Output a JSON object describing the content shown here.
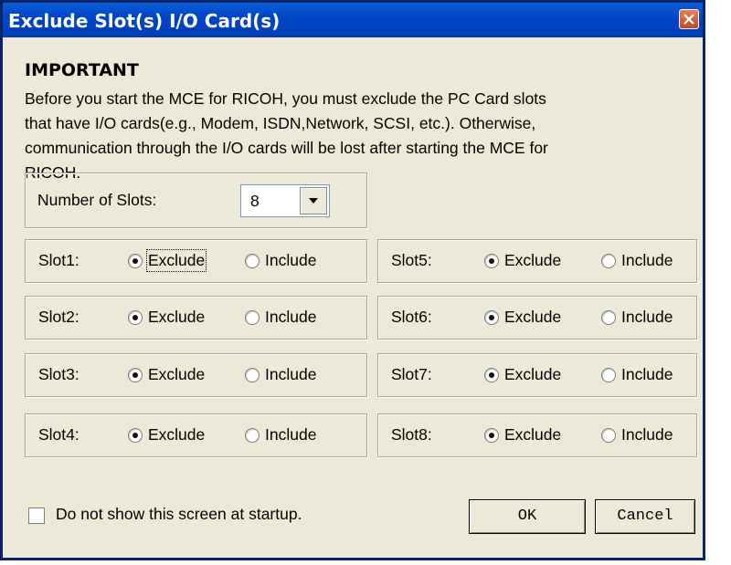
{
  "window": {
    "title": "Exclude Slot(s) I/O Card(s)"
  },
  "notice": {
    "heading": "IMPORTANT",
    "lines": [
      "Before you start the MCE for RICOH, you must exclude the PC Card slots",
      "that have I/O cards(e.g., Modem, ISDN,Network, SCSI, etc.). Otherwise,",
      "communication through the I/O cards will be lost after starting the MCE for",
      "RICOH."
    ]
  },
  "slot_count": {
    "label": "Number of Slots:",
    "value": "8"
  },
  "slots": [
    {
      "label": "Slot1:",
      "exclude": "Exclude",
      "include": "Include",
      "selected": "exclude"
    },
    {
      "label": "Slot2:",
      "exclude": "Exclude",
      "include": "Include",
      "selected": "exclude"
    },
    {
      "label": "Slot3:",
      "exclude": "Exclude",
      "include": "Include",
      "selected": "exclude"
    },
    {
      "label": "Slot4:",
      "exclude": "Exclude",
      "include": "Include",
      "selected": "exclude"
    },
    {
      "label": "Slot5:",
      "exclude": "Exclude",
      "include": "Include",
      "selected": "exclude"
    },
    {
      "label": "Slot6:",
      "exclude": "Exclude",
      "include": "Include",
      "selected": "exclude"
    },
    {
      "label": "Slot7:",
      "exclude": "Exclude",
      "include": "Include",
      "selected": "exclude"
    },
    {
      "label": "Slot8:",
      "exclude": "Exclude",
      "include": "Include",
      "selected": "exclude"
    }
  ],
  "startup": {
    "label": "Do not show this screen at startup.",
    "checked": false
  },
  "buttons": {
    "ok": "OK",
    "cancel": "Cancel"
  },
  "icons": {
    "close": "close-icon",
    "dropdown": "chevron-down-icon"
  }
}
